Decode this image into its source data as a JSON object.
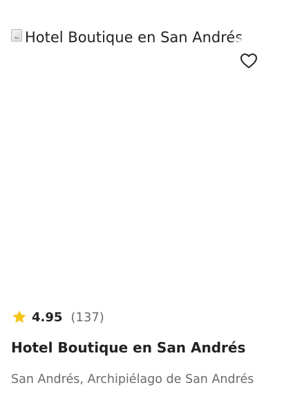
{
  "listing": {
    "image_alt": "Hotel Boutique en San Andrés",
    "title": "Hotel Boutique en San Andrés",
    "location": "San Andrés, Archipiélago de San Andrés",
    "rating": "4.95",
    "review_count": "(137)",
    "favorite_icon": "heart-outline-icon",
    "rating_icon": "star-icon",
    "star_color": "#f5c518"
  }
}
